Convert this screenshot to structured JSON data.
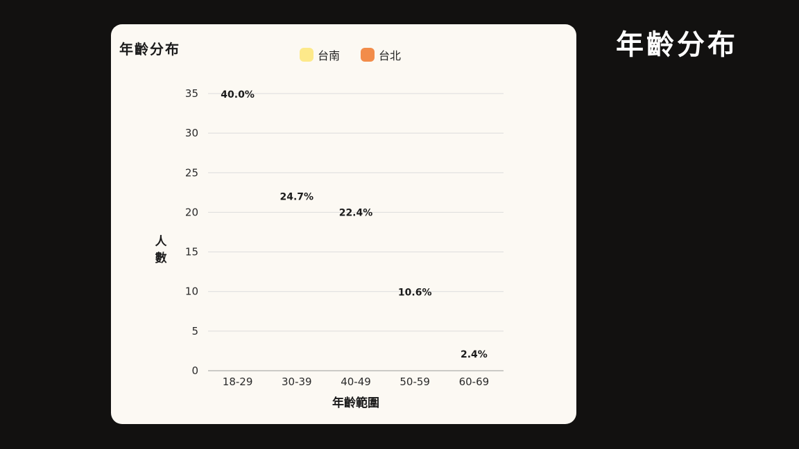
{
  "page": {
    "title": "年齡分布"
  },
  "chart_data": {
    "type": "bar",
    "title": "年齡分布",
    "xlabel": "年齡範圍",
    "ylabel": "人數",
    "categories": [
      "18-29",
      "30-39",
      "40-49",
      "50-59",
      "60-69"
    ],
    "series": [
      {
        "name": "台南",
        "color": "#fde98a",
        "values": [
          0,
          0,
          0,
          0,
          0
        ]
      },
      {
        "name": "台北",
        "color": "#f28c4a",
        "values": [
          0,
          0,
          0,
          0,
          0
        ]
      }
    ],
    "data_labels": [
      "40.0%",
      "24.7%",
      "22.4%",
      "10.6%",
      "2.4%"
    ],
    "label_values": [
      35,
      22.1,
      20.1,
      10,
      2.2
    ],
    "ylim": [
      0,
      35
    ],
    "yticks": [
      0,
      5,
      10,
      15,
      20,
      25,
      30,
      35
    ],
    "grid": true,
    "legend_position": "top-center"
  }
}
